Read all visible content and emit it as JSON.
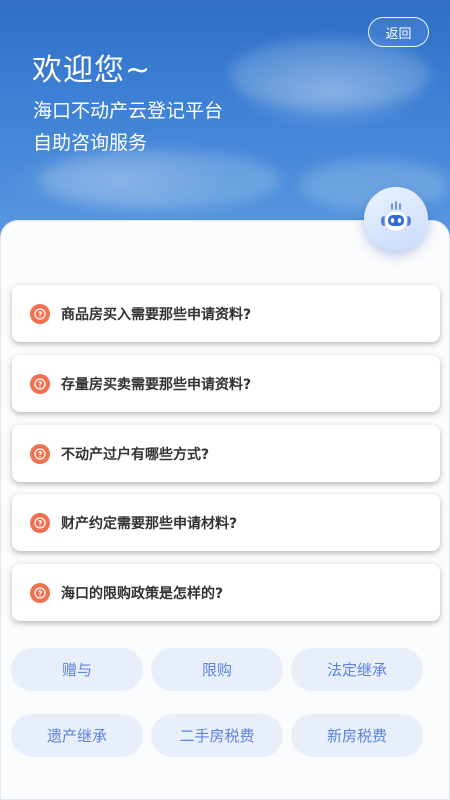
{
  "header": {
    "back_label": "返回",
    "welcome": "欢迎您~",
    "platform_name": "海口不动产云登记平台",
    "service_name": "自助咨询服务"
  },
  "assistant": {
    "icon": "robot-icon"
  },
  "faq": [
    {
      "question": "商品房买入需要那些申请资料?"
    },
    {
      "question": "存量房买卖需要那些申请资料?"
    },
    {
      "question": "不动产过户有哪些方式?"
    },
    {
      "question": "财产约定需要那些申请材料?"
    },
    {
      "question": "海口的限购政策是怎样的?"
    }
  ],
  "tags": [
    {
      "label": "赠与"
    },
    {
      "label": "限购"
    },
    {
      "label": "法定继承"
    },
    {
      "label": "遗产继承"
    },
    {
      "label": "二手房税费"
    },
    {
      "label": "新房税费"
    }
  ],
  "colors": {
    "hero_blue": "#3f82d6",
    "faq_icon": "#f07050",
    "tag_bg": "#e9eefb",
    "tag_text": "#5b83e0"
  }
}
